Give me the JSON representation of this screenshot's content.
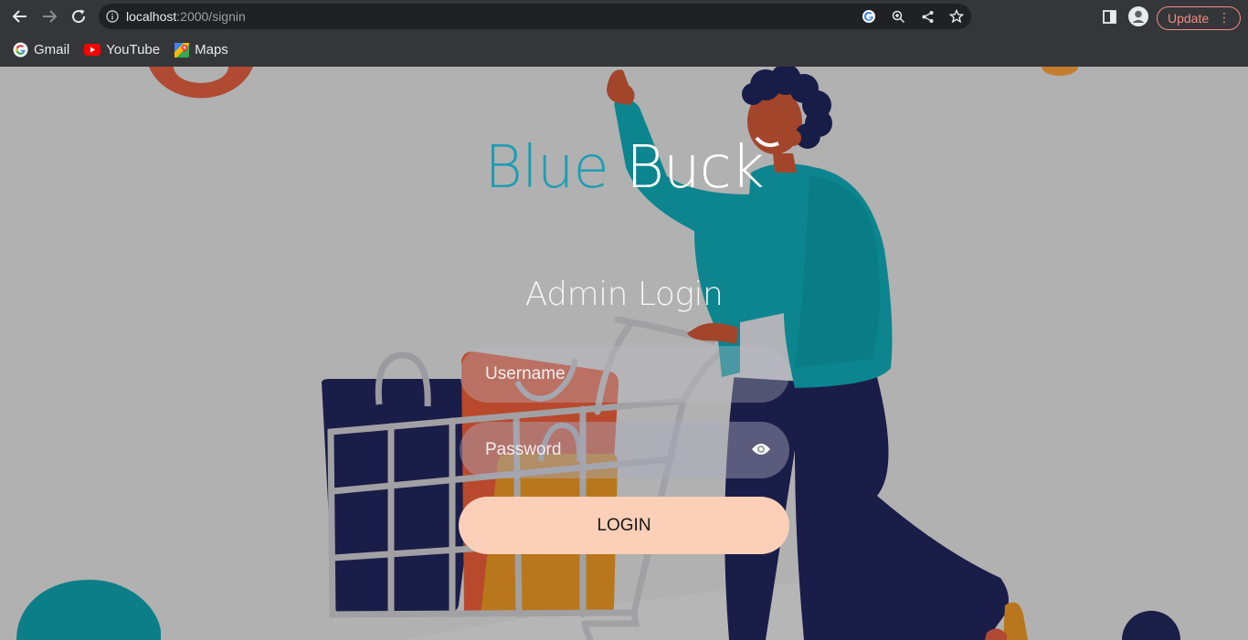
{
  "browser": {
    "url_host": "localhost",
    "url_path": ":2000/signin",
    "update_label": "Update",
    "bookmarks": [
      {
        "label": "Gmail",
        "icon": "gmail-icon"
      },
      {
        "label": "YouTube",
        "icon": "youtube-icon"
      },
      {
        "label": "Maps",
        "icon": "maps-icon"
      }
    ]
  },
  "brand": {
    "word1": "Blue",
    "word2": "Buck",
    "word1_color": "#1e9db3",
    "word2_color": "#ffffff"
  },
  "login": {
    "heading": "Admin Login",
    "username_placeholder": "Username",
    "password_placeholder": "Password",
    "submit_label": "LOGIN",
    "button_color": "#fbcfb8"
  }
}
